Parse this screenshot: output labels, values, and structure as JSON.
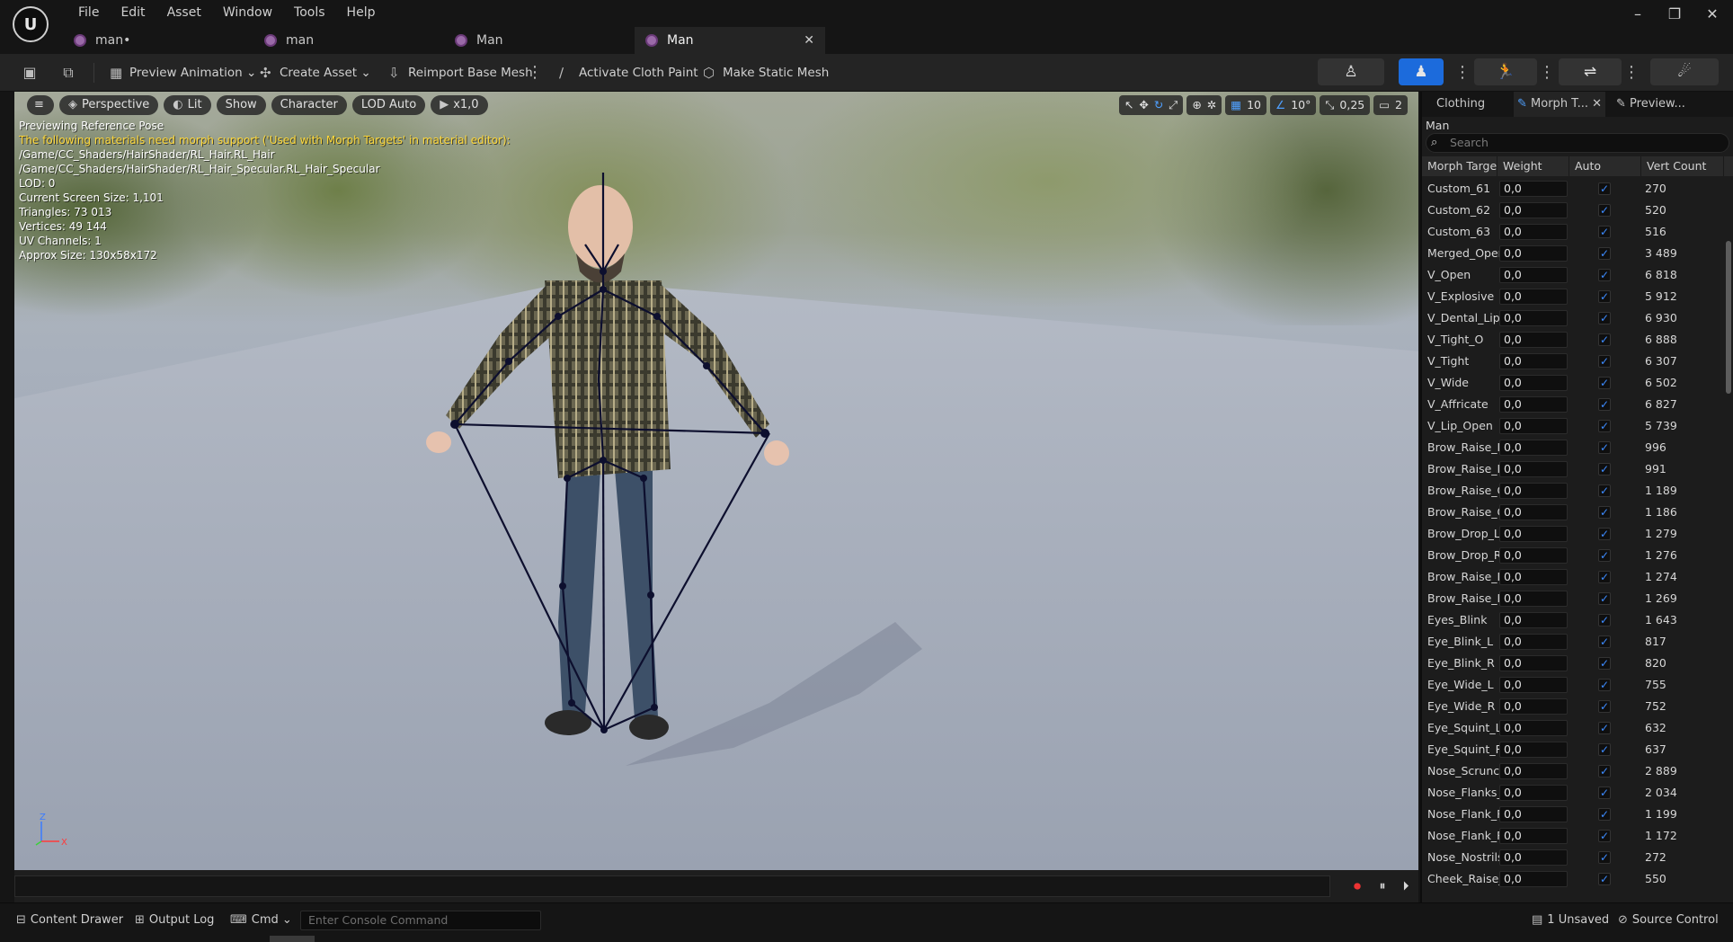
{
  "menu": [
    "File",
    "Edit",
    "Asset",
    "Window",
    "Tools",
    "Help"
  ],
  "tabs": [
    {
      "label": "man•"
    },
    {
      "label": "man"
    },
    {
      "label": "Man"
    },
    {
      "label": "Man",
      "active": true
    }
  ],
  "toolbar": {
    "preview_animation": "Preview Animation",
    "create_asset": "Create Asset",
    "reimport": "Reimport Base Mesh",
    "cloth_paint": "Activate Cloth Paint",
    "static_mesh": "Make Static Mesh"
  },
  "viewport": {
    "perspective": "Perspective",
    "lit": "Lit",
    "show": "Show",
    "character": "Character",
    "lod": "LOD Auto",
    "speed": "x1,0",
    "grid_snap": "10",
    "angle_snap": "10°",
    "scale_snap": "0,25",
    "camera_speed": "2",
    "info": {
      "line1": "Previewing Reference Pose",
      "line2": "The following materials need morph support ('Used with Morph Targets' in material editor):",
      "line3": "/Game/CC_Shaders/HairShader/RL_Hair.RL_Hair",
      "line4": "/Game/CC_Shaders/HairShader/RL_Hair_Specular.RL_Hair_Specular",
      "line5": "LOD: 0",
      "line6": "Current Screen Size: 1,101",
      "line7": "Triangles: 73 013",
      "line8": "Vertices: 49 144",
      "line9": "UV Channels: 1",
      "line10": "Approx Size: 130x58x172"
    },
    "axis_z": "Z",
    "axis_x": "X"
  },
  "panel": {
    "tab_clothing": "Clothing",
    "tab_morph": "Morph T...",
    "tab_preview": "Preview...",
    "header": "Man",
    "search_placeholder": "Search",
    "col_name": "Morph Targe",
    "col_weight": "Weight",
    "col_auto": "Auto",
    "col_vert": "Vert Count",
    "rows": [
      {
        "name": "Custom_61",
        "weight": "0,0",
        "vc": "270"
      },
      {
        "name": "Custom_62",
        "weight": "0,0",
        "vc": "520"
      },
      {
        "name": "Custom_63",
        "weight": "0,0",
        "vc": "516"
      },
      {
        "name": "Merged_Open",
        "weight": "0,0",
        "vc": "3 489"
      },
      {
        "name": "V_Open",
        "weight": "0,0",
        "vc": "6 818"
      },
      {
        "name": "V_Explosive",
        "weight": "0,0",
        "vc": "5 912"
      },
      {
        "name": "V_Dental_Lip",
        "weight": "0,0",
        "vc": "6 930"
      },
      {
        "name": "V_Tight_O",
        "weight": "0,0",
        "vc": "6 888"
      },
      {
        "name": "V_Tight",
        "weight": "0,0",
        "vc": "6 307"
      },
      {
        "name": "V_Wide",
        "weight": "0,0",
        "vc": "6 502"
      },
      {
        "name": "V_Affricate",
        "weight": "0,0",
        "vc": "6 827"
      },
      {
        "name": "V_Lip_Open",
        "weight": "0,0",
        "vc": "5 739"
      },
      {
        "name": "Brow_Raise_In",
        "weight": "0,0",
        "vc": "996"
      },
      {
        "name": "Brow_Raise_In",
        "weight": "0,0",
        "vc": "991"
      },
      {
        "name": "Brow_Raise_O",
        "weight": "0,0",
        "vc": "1 189"
      },
      {
        "name": "Brow_Raise_O",
        "weight": "0,0",
        "vc": "1 186"
      },
      {
        "name": "Brow_Drop_Le",
        "weight": "0,0",
        "vc": "1 279"
      },
      {
        "name": "Brow_Drop_Ri",
        "weight": "0,0",
        "vc": "1 276"
      },
      {
        "name": "Brow_Raise_L",
        "weight": "0,0",
        "vc": "1 274"
      },
      {
        "name": "Brow_Raise_F",
        "weight": "0,0",
        "vc": "1 269"
      },
      {
        "name": "Eyes_Blink",
        "weight": "0,0",
        "vc": "1 643"
      },
      {
        "name": "Eye_Blink_L",
        "weight": "0,0",
        "vc": "817"
      },
      {
        "name": "Eye_Blink_R",
        "weight": "0,0",
        "vc": "820"
      },
      {
        "name": "Eye_Wide_L",
        "weight": "0,0",
        "vc": "755"
      },
      {
        "name": "Eye_Wide_R",
        "weight": "0,0",
        "vc": "752"
      },
      {
        "name": "Eye_Squint_L",
        "weight": "0,0",
        "vc": "632"
      },
      {
        "name": "Eye_Squint_R",
        "weight": "0,0",
        "vc": "637"
      },
      {
        "name": "Nose_Scrunch",
        "weight": "0,0",
        "vc": "2 889"
      },
      {
        "name": "Nose_Flanks_",
        "weight": "0,0",
        "vc": "2 034"
      },
      {
        "name": "Nose_Flank_R",
        "weight": "0,0",
        "vc": "1 199"
      },
      {
        "name": "Nose_Flank_R",
        "weight": "0,0",
        "vc": "1 172"
      },
      {
        "name": "Nose_Nostrils",
        "weight": "0,0",
        "vc": "272"
      },
      {
        "name": "Cheek_Raise_",
        "weight": "0,0",
        "vc": "550"
      }
    ]
  },
  "status": {
    "content_drawer": "Content Drawer",
    "output_log": "Output Log",
    "cmd": "Cmd",
    "console_placeholder": "Enter Console Command",
    "unsaved": "1 Unsaved",
    "source_control": "Source Control"
  },
  "colors": {
    "accent": "#1c6bdc",
    "warning_text": "#ffd83a",
    "panel_bg": "#1c1c1c"
  }
}
